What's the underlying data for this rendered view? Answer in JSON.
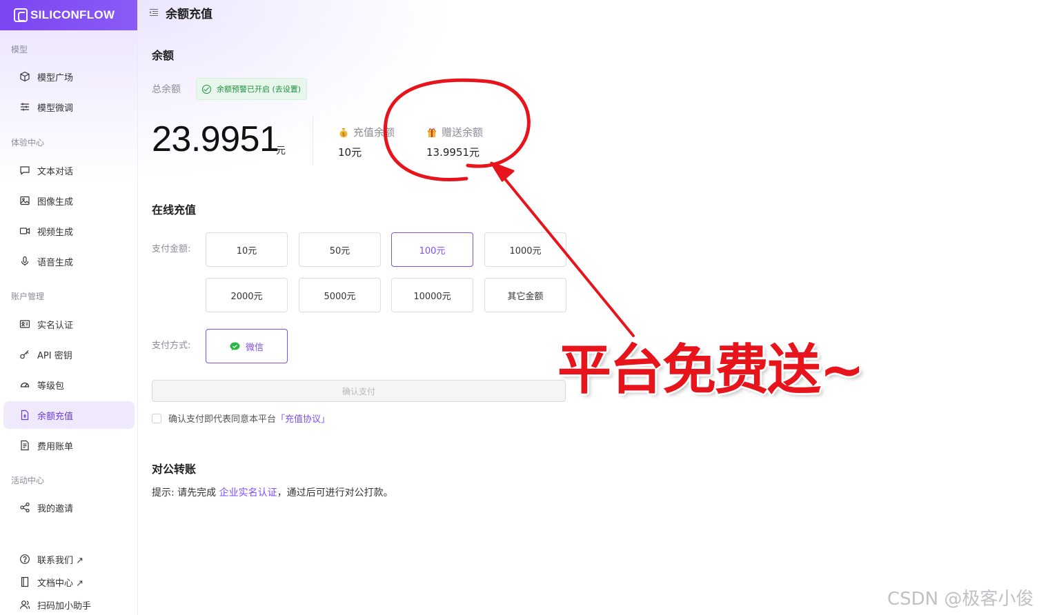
{
  "brand": {
    "name": "SILICONFLOW",
    "accent": "#7c4dff"
  },
  "sidebar": {
    "sections": [
      {
        "label": "模型",
        "items": [
          {
            "label": "模型广场",
            "icon": "cube-icon"
          },
          {
            "label": "模型微调",
            "icon": "sliders-icon"
          }
        ]
      },
      {
        "label": "体验中心",
        "items": [
          {
            "label": "文本对话",
            "icon": "chat-icon"
          },
          {
            "label": "图像生成",
            "icon": "image-icon"
          },
          {
            "label": "视频生成",
            "icon": "video-icon"
          },
          {
            "label": "语音生成",
            "icon": "mic-icon"
          }
        ]
      },
      {
        "label": "账户管理",
        "items": [
          {
            "label": "实名认证",
            "icon": "id-card-icon"
          },
          {
            "label": "API 密钥",
            "icon": "key-icon"
          },
          {
            "label": "等级包",
            "icon": "gauge-icon"
          },
          {
            "label": "余额充值",
            "icon": "wallet-icon",
            "active": true
          },
          {
            "label": "费用账单",
            "icon": "bill-icon"
          }
        ]
      },
      {
        "label": "活动中心",
        "items": [
          {
            "label": "我的邀请",
            "icon": "share-icon"
          }
        ]
      }
    ],
    "footer": [
      {
        "label": "联系我们 ↗",
        "icon": "help-icon"
      },
      {
        "label": "文档中心 ↗",
        "icon": "doc-icon"
      },
      {
        "label": "扫码加小助手",
        "icon": "user-icon"
      }
    ]
  },
  "header": {
    "title": "余额充值"
  },
  "balance": {
    "section_title": "余额",
    "total_label": "总余额",
    "alert_badge": "余额预警已开启 (去设置)",
    "total_value": "23.9951",
    "unit": "元",
    "recharge_label": "充值余额",
    "recharge_value": "10元",
    "gift_label": "赠送余额",
    "gift_value": "13.9951元"
  },
  "recharge": {
    "section_title": "在线充值",
    "amount_label": "支付金额:",
    "amounts": [
      "10元",
      "50元",
      "100元",
      "1000元",
      "2000元",
      "5000元",
      "10000元",
      "其它金额"
    ],
    "selected_amount": "100元",
    "method_label": "支付方式:",
    "method": "微信",
    "confirm_button": "确认支付",
    "agree_text": "确认支付即代表同意本平台",
    "agree_link": "「充值协议」"
  },
  "transfer": {
    "section_title": "对公转账",
    "tip_prefix": "提示: 请先完成 ",
    "tip_link": "企业实名认证",
    "tip_suffix": "，通过后可进行对公打款。"
  },
  "annotation": {
    "text": "平台免费送~",
    "color": "#e8141c"
  },
  "watermark": "CSDN @极客小俊"
}
